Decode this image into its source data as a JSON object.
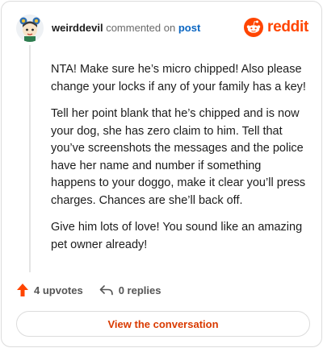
{
  "header": {
    "username": "weirddevil",
    "action_text": "commented on",
    "post_link": "post",
    "brand": "reddit"
  },
  "comment": {
    "paragraphs": [
      "NTA! Make sure he’s micro chipped! Also please change your locks if any of your family has a key!",
      "Tell her point blank that he’s chipped and is now your dog, she has zero claim to him. Tell that you’ve screenshots the messages and the police have her name and number if something happens to your doggo, make it clear you’ll press charges. Chances are she’ll back off.",
      "Give him lots of love! You sound like an amazing pet owner already!"
    ]
  },
  "actions": {
    "upvotes": "4 upvotes",
    "replies": "0 replies",
    "upvote_icon": "upvote-arrow-icon",
    "reply_icon": "reply-arrow-icon"
  },
  "footer": {
    "view_button": "View the conversation"
  },
  "colors": {
    "brand": "#ff4500",
    "link": "#0a66c2",
    "button_text": "#d93a00"
  }
}
